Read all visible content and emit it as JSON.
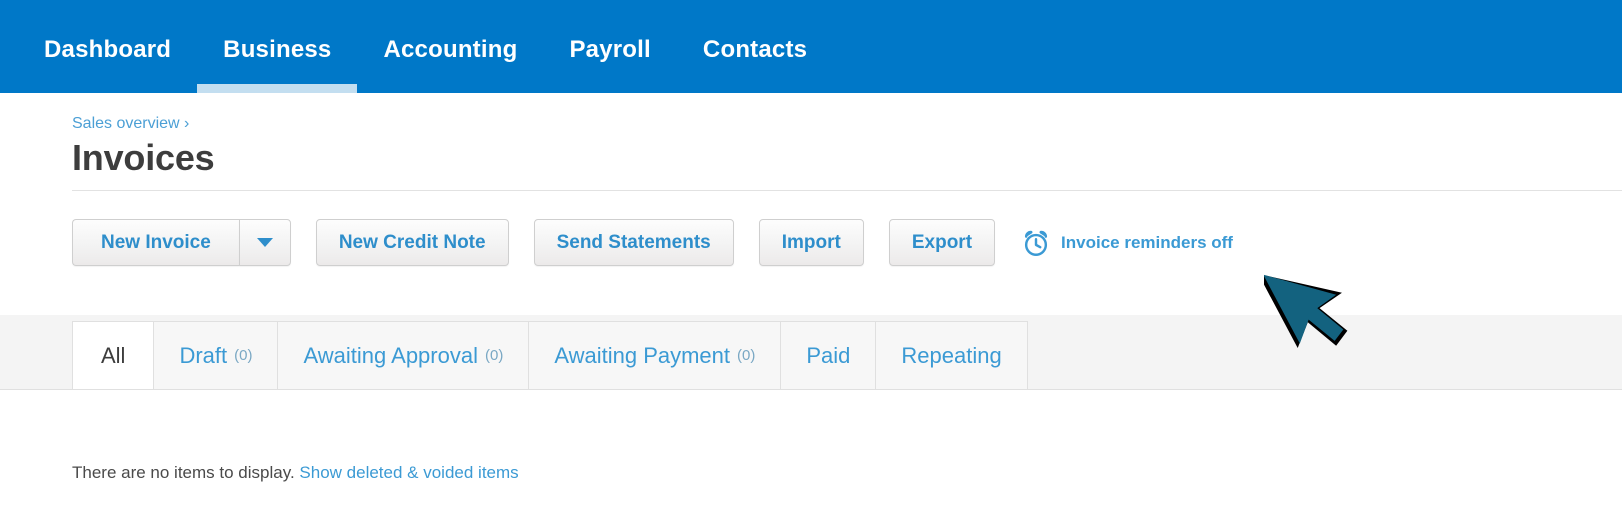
{
  "nav": {
    "items": [
      {
        "label": "Dashboard",
        "active": false
      },
      {
        "label": "Business",
        "active": true
      },
      {
        "label": "Accounting",
        "active": false
      },
      {
        "label": "Payroll",
        "active": false
      },
      {
        "label": "Contacts",
        "active": false
      }
    ]
  },
  "header": {
    "breadcrumb": "Sales overview ›",
    "title": "Invoices"
  },
  "toolbar": {
    "new_invoice_label": "New Invoice",
    "new_invoice_caret": "chevron-down-icon",
    "new_credit_note_label": "New Credit Note",
    "send_statements_label": "Send Statements",
    "import_label": "Import",
    "export_label": "Export",
    "reminders_icon": "alarm-clock-icon",
    "reminders_label": "Invoice reminders off"
  },
  "tabs": [
    {
      "label": "All",
      "count": "",
      "active": true
    },
    {
      "label": "Draft",
      "count": "(0)",
      "active": false
    },
    {
      "label": "Awaiting Approval",
      "count": "(0)",
      "active": false
    },
    {
      "label": "Awaiting Payment",
      "count": "(0)",
      "active": false
    },
    {
      "label": "Paid",
      "count": "",
      "active": false
    },
    {
      "label": "Repeating",
      "count": "",
      "active": false
    }
  ],
  "content": {
    "empty_message": "There are no items to display.",
    "show_deleted_link": "Show deleted & voided items"
  },
  "colors": {
    "nav_blue": "#0078c8",
    "nav_active_underline": "#c3def0",
    "link_blue": "#3b9ad4",
    "button_text": "#2e8ecb",
    "title_gray": "#3d3d3d",
    "tabstrip_gray": "#f4f4f4",
    "cursor_teal": "#13627f"
  },
  "cursor": {
    "icon": "mouse-pointer-arrow"
  }
}
